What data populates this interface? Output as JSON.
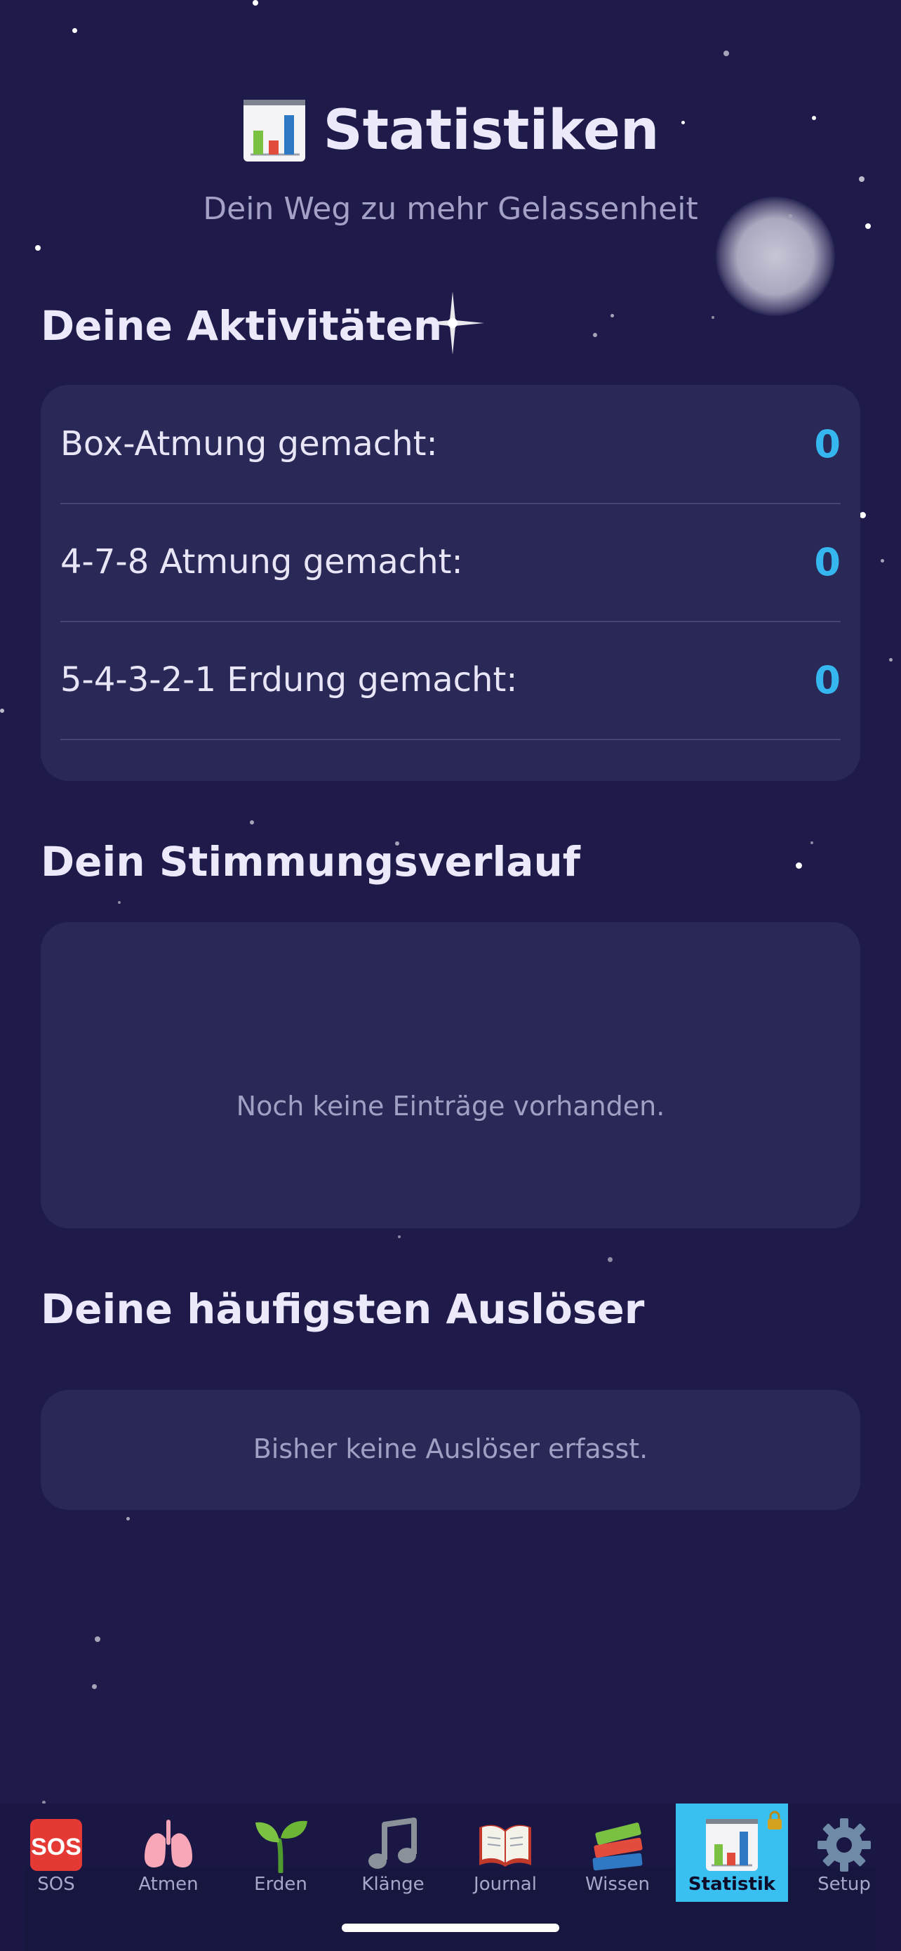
{
  "header": {
    "title": "Statistiken",
    "subtitle": "Dein Weg zu mehr Gelassenheit",
    "icon": "bar-chart-icon"
  },
  "activities": {
    "title": "Deine Aktivitäten",
    "rows": [
      {
        "label": "Box-Atmung gemacht:",
        "value": "0"
      },
      {
        "label": "4-7-8 Atmung gemacht:",
        "value": "0"
      },
      {
        "label": "5-4-3-2-1 Erdung gemacht:",
        "value": "0"
      }
    ]
  },
  "mood": {
    "title": "Dein Stimmungsverlauf",
    "empty_text": "Noch keine Einträge vorhanden."
  },
  "triggers": {
    "title": "Deine häufigsten Auslöser",
    "empty_text": "Bisher keine Auslöser erfasst."
  },
  "tabs": [
    {
      "label": "SOS",
      "icon": "sos-icon",
      "active": false
    },
    {
      "label": "Atmen",
      "icon": "lungs-icon",
      "active": false
    },
    {
      "label": "Erden",
      "icon": "seedling-icon",
      "active": false
    },
    {
      "label": "Klänge",
      "icon": "music-note-icon",
      "active": false
    },
    {
      "label": "Journal",
      "icon": "open-book-icon",
      "active": false
    },
    {
      "label": "Wissen",
      "icon": "books-icon",
      "active": false
    },
    {
      "label": "Statistik",
      "icon": "bar-chart-icon",
      "active": true
    },
    {
      "label": "Setup",
      "icon": "gear-icon",
      "active": false
    }
  ],
  "colors": {
    "background": "#1e1b4b",
    "card": "#2a2856",
    "accent": "#35b6ef",
    "active_tab": "#3ac0f0"
  }
}
